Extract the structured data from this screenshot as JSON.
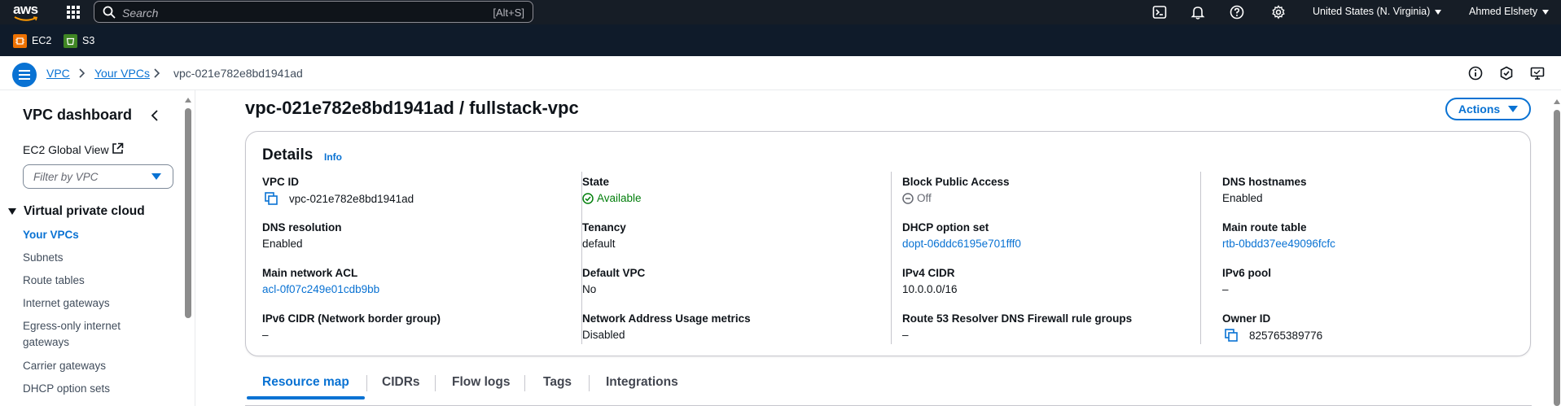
{
  "topbar": {
    "logo_text": "aws",
    "search_placeholder": "Search",
    "search_shortcut": "[Alt+S]",
    "region": "United States (N. Virginia)",
    "user": "Ahmed Elshety",
    "icons": [
      "cloudshell-icon",
      "bell-icon",
      "help-icon",
      "gear-icon"
    ]
  },
  "favorites": [
    {
      "label": "EC2",
      "color": "#ed7100"
    },
    {
      "label": "S3",
      "color": "#3f8624"
    }
  ],
  "breadcrumb": {
    "items": [
      "VPC",
      "Your VPCs"
    ],
    "current": "vpc-021e782e8bd1941ad"
  },
  "sidebar": {
    "title": "VPC dashboard",
    "ec2_global_view": "EC2 Global View",
    "filter_placeholder": "Filter by VPC",
    "section": "Virtual private cloud",
    "items": [
      {
        "label": "Your VPCs",
        "active": true
      },
      {
        "label": "Subnets"
      },
      {
        "label": "Route tables"
      },
      {
        "label": "Internet gateways"
      },
      {
        "label": "Egress-only internet gateways"
      },
      {
        "label": "Carrier gateways"
      },
      {
        "label": "DHCP option sets"
      }
    ]
  },
  "page": {
    "title": "vpc-021e782e8bd1941ad / fullstack-vpc",
    "actions_label": "Actions"
  },
  "details": {
    "title": "Details",
    "info": "Info",
    "fields": {
      "vpc_id": {
        "label": "VPC ID",
        "value": "vpc-021e782e8bd1941ad"
      },
      "dns_resolution": {
        "label": "DNS resolution",
        "value": "Enabled"
      },
      "main_network_acl": {
        "label": "Main network ACL",
        "value": "acl-0f07c249e01cdb9bb"
      },
      "ipv6_cidr": {
        "label": "IPv6 CIDR (Network border group)",
        "value": "–"
      },
      "state": {
        "label": "State",
        "value": "Available"
      },
      "tenancy": {
        "label": "Tenancy",
        "value": "default"
      },
      "default_vpc": {
        "label": "Default VPC",
        "value": "No"
      },
      "nau_metrics": {
        "label": "Network Address Usage metrics",
        "value": "Disabled"
      },
      "block_public_access": {
        "label": "Block Public Access",
        "value": "Off"
      },
      "dhcp_option_set": {
        "label": "DHCP option set",
        "value": "dopt-06ddc6195e701fff0"
      },
      "ipv4_cidr": {
        "label": "IPv4 CIDR",
        "value": "10.0.0.0/16"
      },
      "route53_resolver": {
        "label": "Route 53 Resolver DNS Firewall rule groups",
        "value": "–"
      },
      "dns_hostnames": {
        "label": "DNS hostnames",
        "value": "Enabled"
      },
      "main_route_table": {
        "label": "Main route table",
        "value": "rtb-0bdd37ee49096fcfc"
      },
      "ipv6_pool": {
        "label": "IPv6 pool",
        "value": "–"
      },
      "owner_id": {
        "label": "Owner ID",
        "value": "825765389776"
      }
    }
  },
  "tabs": [
    "Resource map",
    "CIDRs",
    "Flow logs",
    "Tags",
    "Integrations"
  ],
  "colors": {
    "accent": "#0972d3",
    "topbar": "#161d26",
    "success": "#037f0c"
  }
}
